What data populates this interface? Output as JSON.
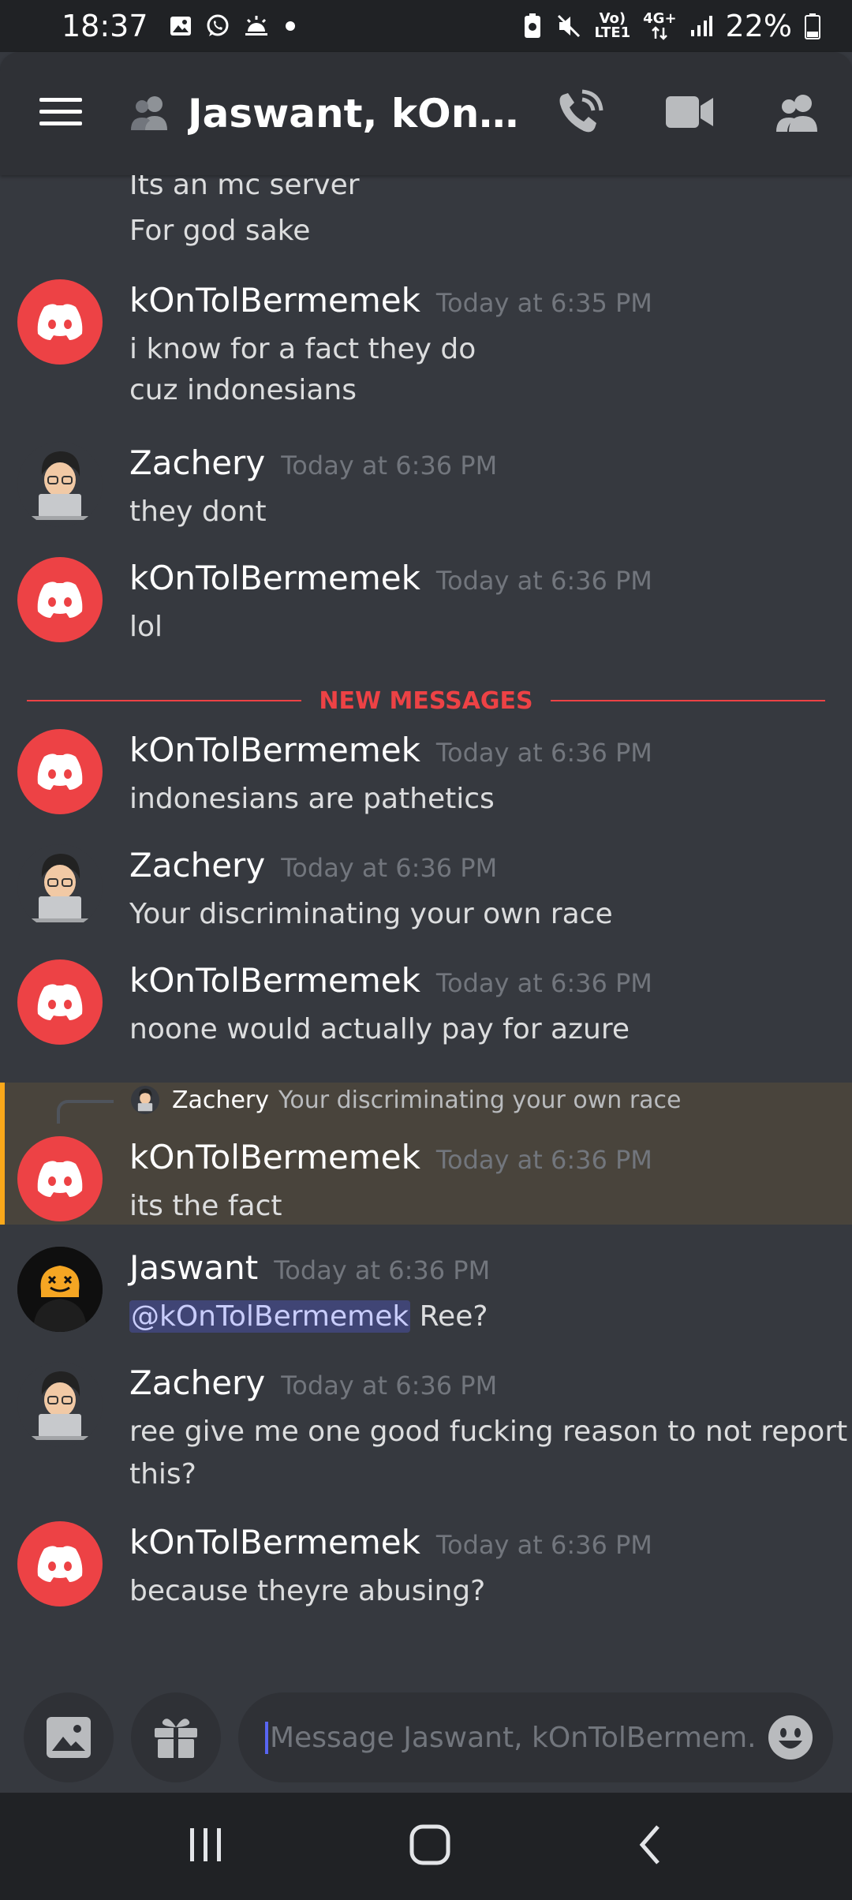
{
  "status_bar": {
    "time": "18:37",
    "network_top": "Vo)",
    "network_bottom": "LTE1",
    "gen_top": "4G+",
    "battery": "22%"
  },
  "header": {
    "title": "Jaswant, kOnTol..."
  },
  "messages": [
    {
      "lines": [
        "Its an mc server",
        "For god sake"
      ]
    },
    {
      "user": "kOnTolBermemek",
      "time": "Today at 6:35 PM",
      "lines": [
        "i know for a fact they do",
        "cuz indonesians"
      ]
    },
    {
      "user": "Zachery",
      "time": "Today at 6:36 PM",
      "lines": [
        "they dont"
      ]
    },
    {
      "user": "kOnTolBermemek",
      "time": "Today at 6:36 PM",
      "lines": [
        "lol"
      ]
    },
    {
      "user": "kOnTolBermemek",
      "time": "Today at 6:36 PM",
      "lines": [
        "indonesians are pathetics"
      ]
    },
    {
      "user": "Zachery",
      "time": "Today at 6:36 PM",
      "lines": [
        "Your discriminating your own race"
      ]
    },
    {
      "user": "kOnTolBermemek",
      "time": "Today at 6:36 PM",
      "lines": [
        "noone would actually pay for azure"
      ]
    },
    {
      "user": "kOnTolBermemek",
      "time": "Today at 6:36 PM",
      "lines": [
        "its the fact"
      ],
      "reply": {
        "user": "Zachery",
        "text": "Your discriminating your own race"
      }
    },
    {
      "user": "Jaswant",
      "time": "Today at 6:36 PM",
      "mention": "@kOnTolBermemek",
      "lines": [
        " Ree?"
      ]
    },
    {
      "user": "Zachery",
      "time": "Today at 6:36 PM",
      "lines": [
        "ree give me one good fucking reason to not report",
        "this?"
      ]
    },
    {
      "user": "kOnTolBermemek",
      "time": "Today at 6:36 PM",
      "lines": [
        "because theyre abusing?"
      ]
    }
  ],
  "divider": {
    "label": "NEW MESSAGES"
  },
  "composer": {
    "placeholder": "Message Jaswant, kOnTolBermem..."
  },
  "colors": {
    "background": "#36393f",
    "header": "#2f3136",
    "discord_red": "#ed4245",
    "mention": "#5865f2",
    "highlight": "#faa81a"
  }
}
